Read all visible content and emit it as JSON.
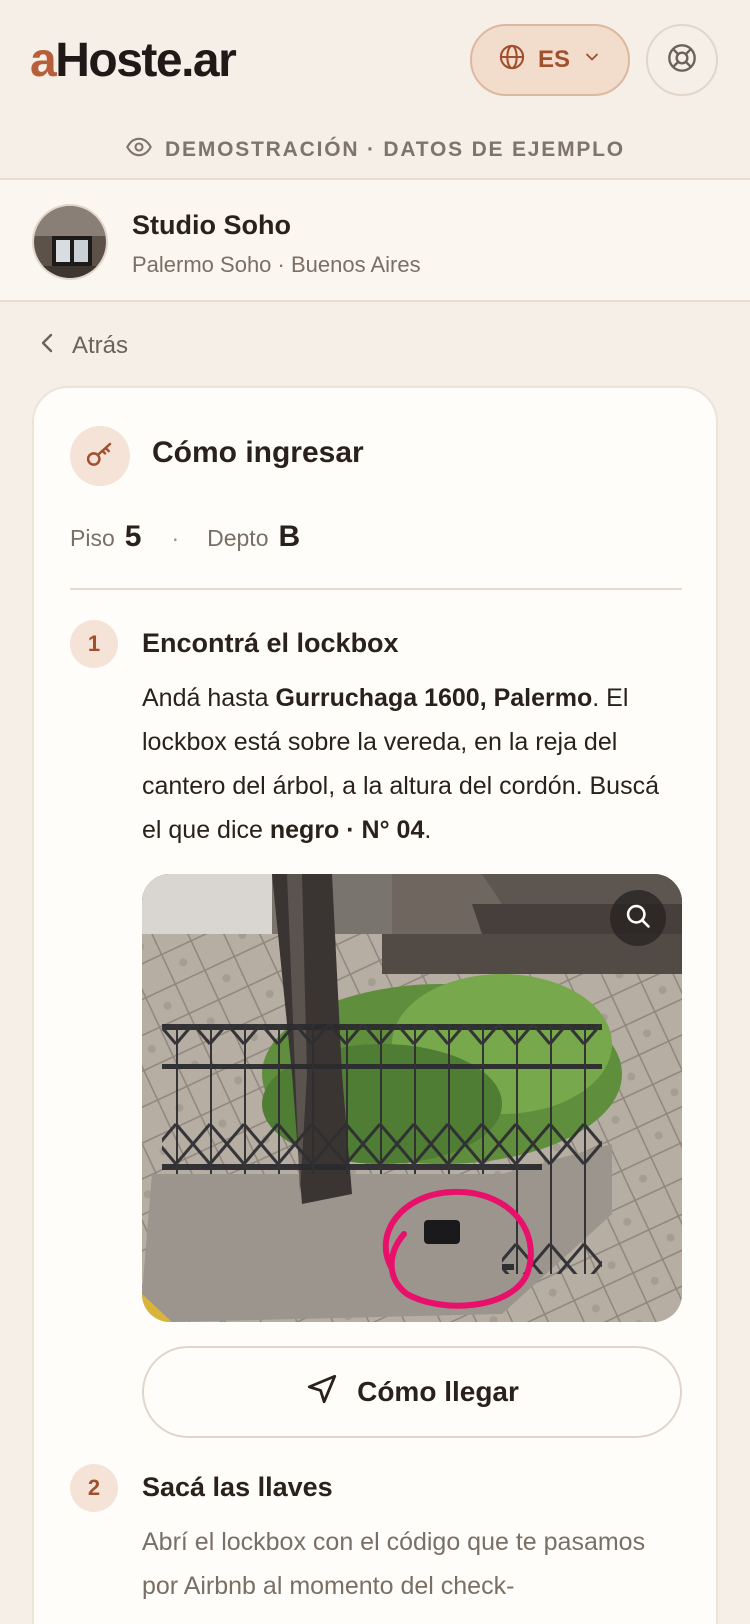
{
  "header": {
    "logo_a": "a",
    "logo_rest": "Hoste.ar",
    "language": "ES",
    "demo_text": "DEMOSTRACIÓN · DATOS DE EJEMPLO"
  },
  "property": {
    "name": "Studio Soho",
    "location": "Palermo Soho · Buenos Aires"
  },
  "nav": {
    "back_label": "Atrás"
  },
  "card": {
    "title": "Cómo ingresar",
    "floor_label": "Piso",
    "floor_value": "5",
    "separator": "·",
    "unit_label": "Depto",
    "unit_value": "B",
    "steps": [
      {
        "number": "1",
        "title": "Encontrá el lockbox",
        "body_1": "Andá hasta ",
        "body_bold_1": "Gurruchaga 1600, Palermo",
        "body_2": ". El lockbox está sobre la vereda, en la reja del cantero del árbol, a la altura del cordón. Buscá el que dice ",
        "body_bold_2": "negro · N° 04",
        "body_3": ".",
        "directions_label": "Cómo llegar"
      },
      {
        "number": "2",
        "title": "Sacá las llaves",
        "body": "Abrí el lockbox con el código que te pasamos por Airbnb al momento del check-"
      }
    ]
  },
  "colors": {
    "background": "#f6efe7",
    "accent": "#a24f2d",
    "accent_soft": "#f5e3d8",
    "card": "#fffdfa",
    "annotation": "#e8106b"
  },
  "icons": [
    "globe-icon",
    "chevron-down-icon",
    "lifebuoy-icon",
    "eye-icon",
    "chevron-left-icon",
    "key-icon",
    "search-icon",
    "navigation-arrow-icon"
  ]
}
